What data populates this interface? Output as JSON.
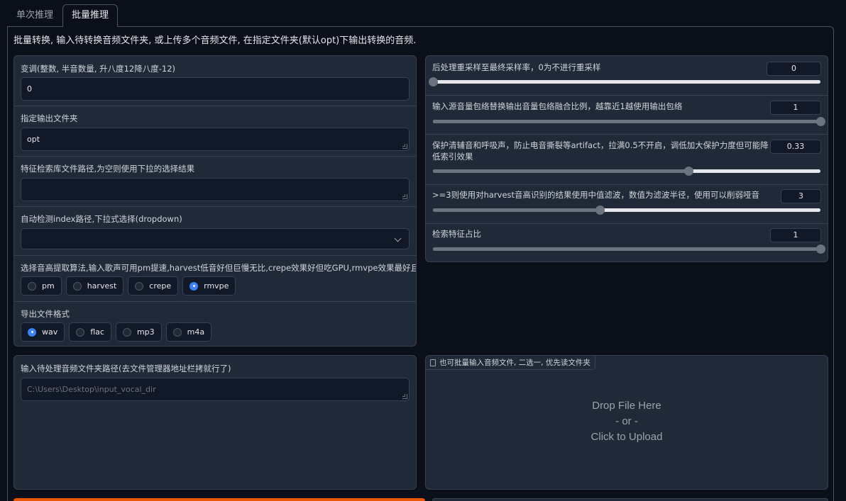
{
  "tabs": [
    {
      "label": "单次推理"
    },
    {
      "label": "批量推理"
    }
  ],
  "intro": "批量转换, 输入待转换音频文件夹, 或上传多个音频文件, 在指定文件夹(默认opt)下输出转换的音频.",
  "left": {
    "transpose": {
      "label": "变调(整数, 半音数量, 升八度12降八度-12)",
      "value": "0"
    },
    "output_dir": {
      "label": "指定输出文件夹",
      "value": "opt"
    },
    "index_path": {
      "label": "特征检索库文件路径,为空则使用下拉的选择结果",
      "value": ""
    },
    "auto_index": {
      "label": "自动检测index路径,下拉式选择(dropdown)",
      "value": ""
    },
    "pitch_algo": {
      "label": "选择音高提取算法,输入歌声可用pm提速,harvest低音好但巨慢无比,crepe效果好但吃GPU,rmvpe效果最好且微吃GPU",
      "options": [
        "pm",
        "harvest",
        "crepe",
        "rmvpe"
      ],
      "selected": "rmvpe"
    },
    "export_format": {
      "label": "导出文件格式",
      "options": [
        "wav",
        "flac",
        "mp3",
        "m4a"
      ],
      "selected": "wav"
    }
  },
  "right": {
    "sliders": [
      {
        "label": "后处理重采样至最终采样率，0为不进行重采样",
        "value": "0",
        "fraction": 0.0
      },
      {
        "label": "输入源音量包络替换输出音量包络融合比例，越靠近1越使用输出包络",
        "value": "1",
        "fraction": 1.0
      },
      {
        "label": "保护清辅音和呼吸声，防止电音撕裂等artifact，拉满0.5不开启，调低加大保护力度但可能降低索引效果",
        "value": "0.33",
        "fraction": 0.66
      },
      {
        "label": ">=3则使用对harvest音高识别的结果使用中值滤波，数值为滤波半径，使用可以削弱哑音",
        "value": "3",
        "fraction": 0.43
      },
      {
        "label": "检索特征占比",
        "value": "1",
        "fraction": 1.0
      }
    ]
  },
  "input_folder": {
    "label": "输入待处理音频文件夹路径(去文件管理器地址栏拷就行了)",
    "placeholder": "C:\\Users\\Desktop\\input_vocal_dir"
  },
  "upload": {
    "tag": "也可批量输入音频文件, 二选一, 优先读文件夹",
    "drop_text": "Drop File Here",
    "or_text": "- or -",
    "click_text": "Click to Upload"
  },
  "colors": {
    "accent": "#3b82f6",
    "button": "#ea580c",
    "background": "#0b0f19",
    "panel": "#1f2937"
  }
}
